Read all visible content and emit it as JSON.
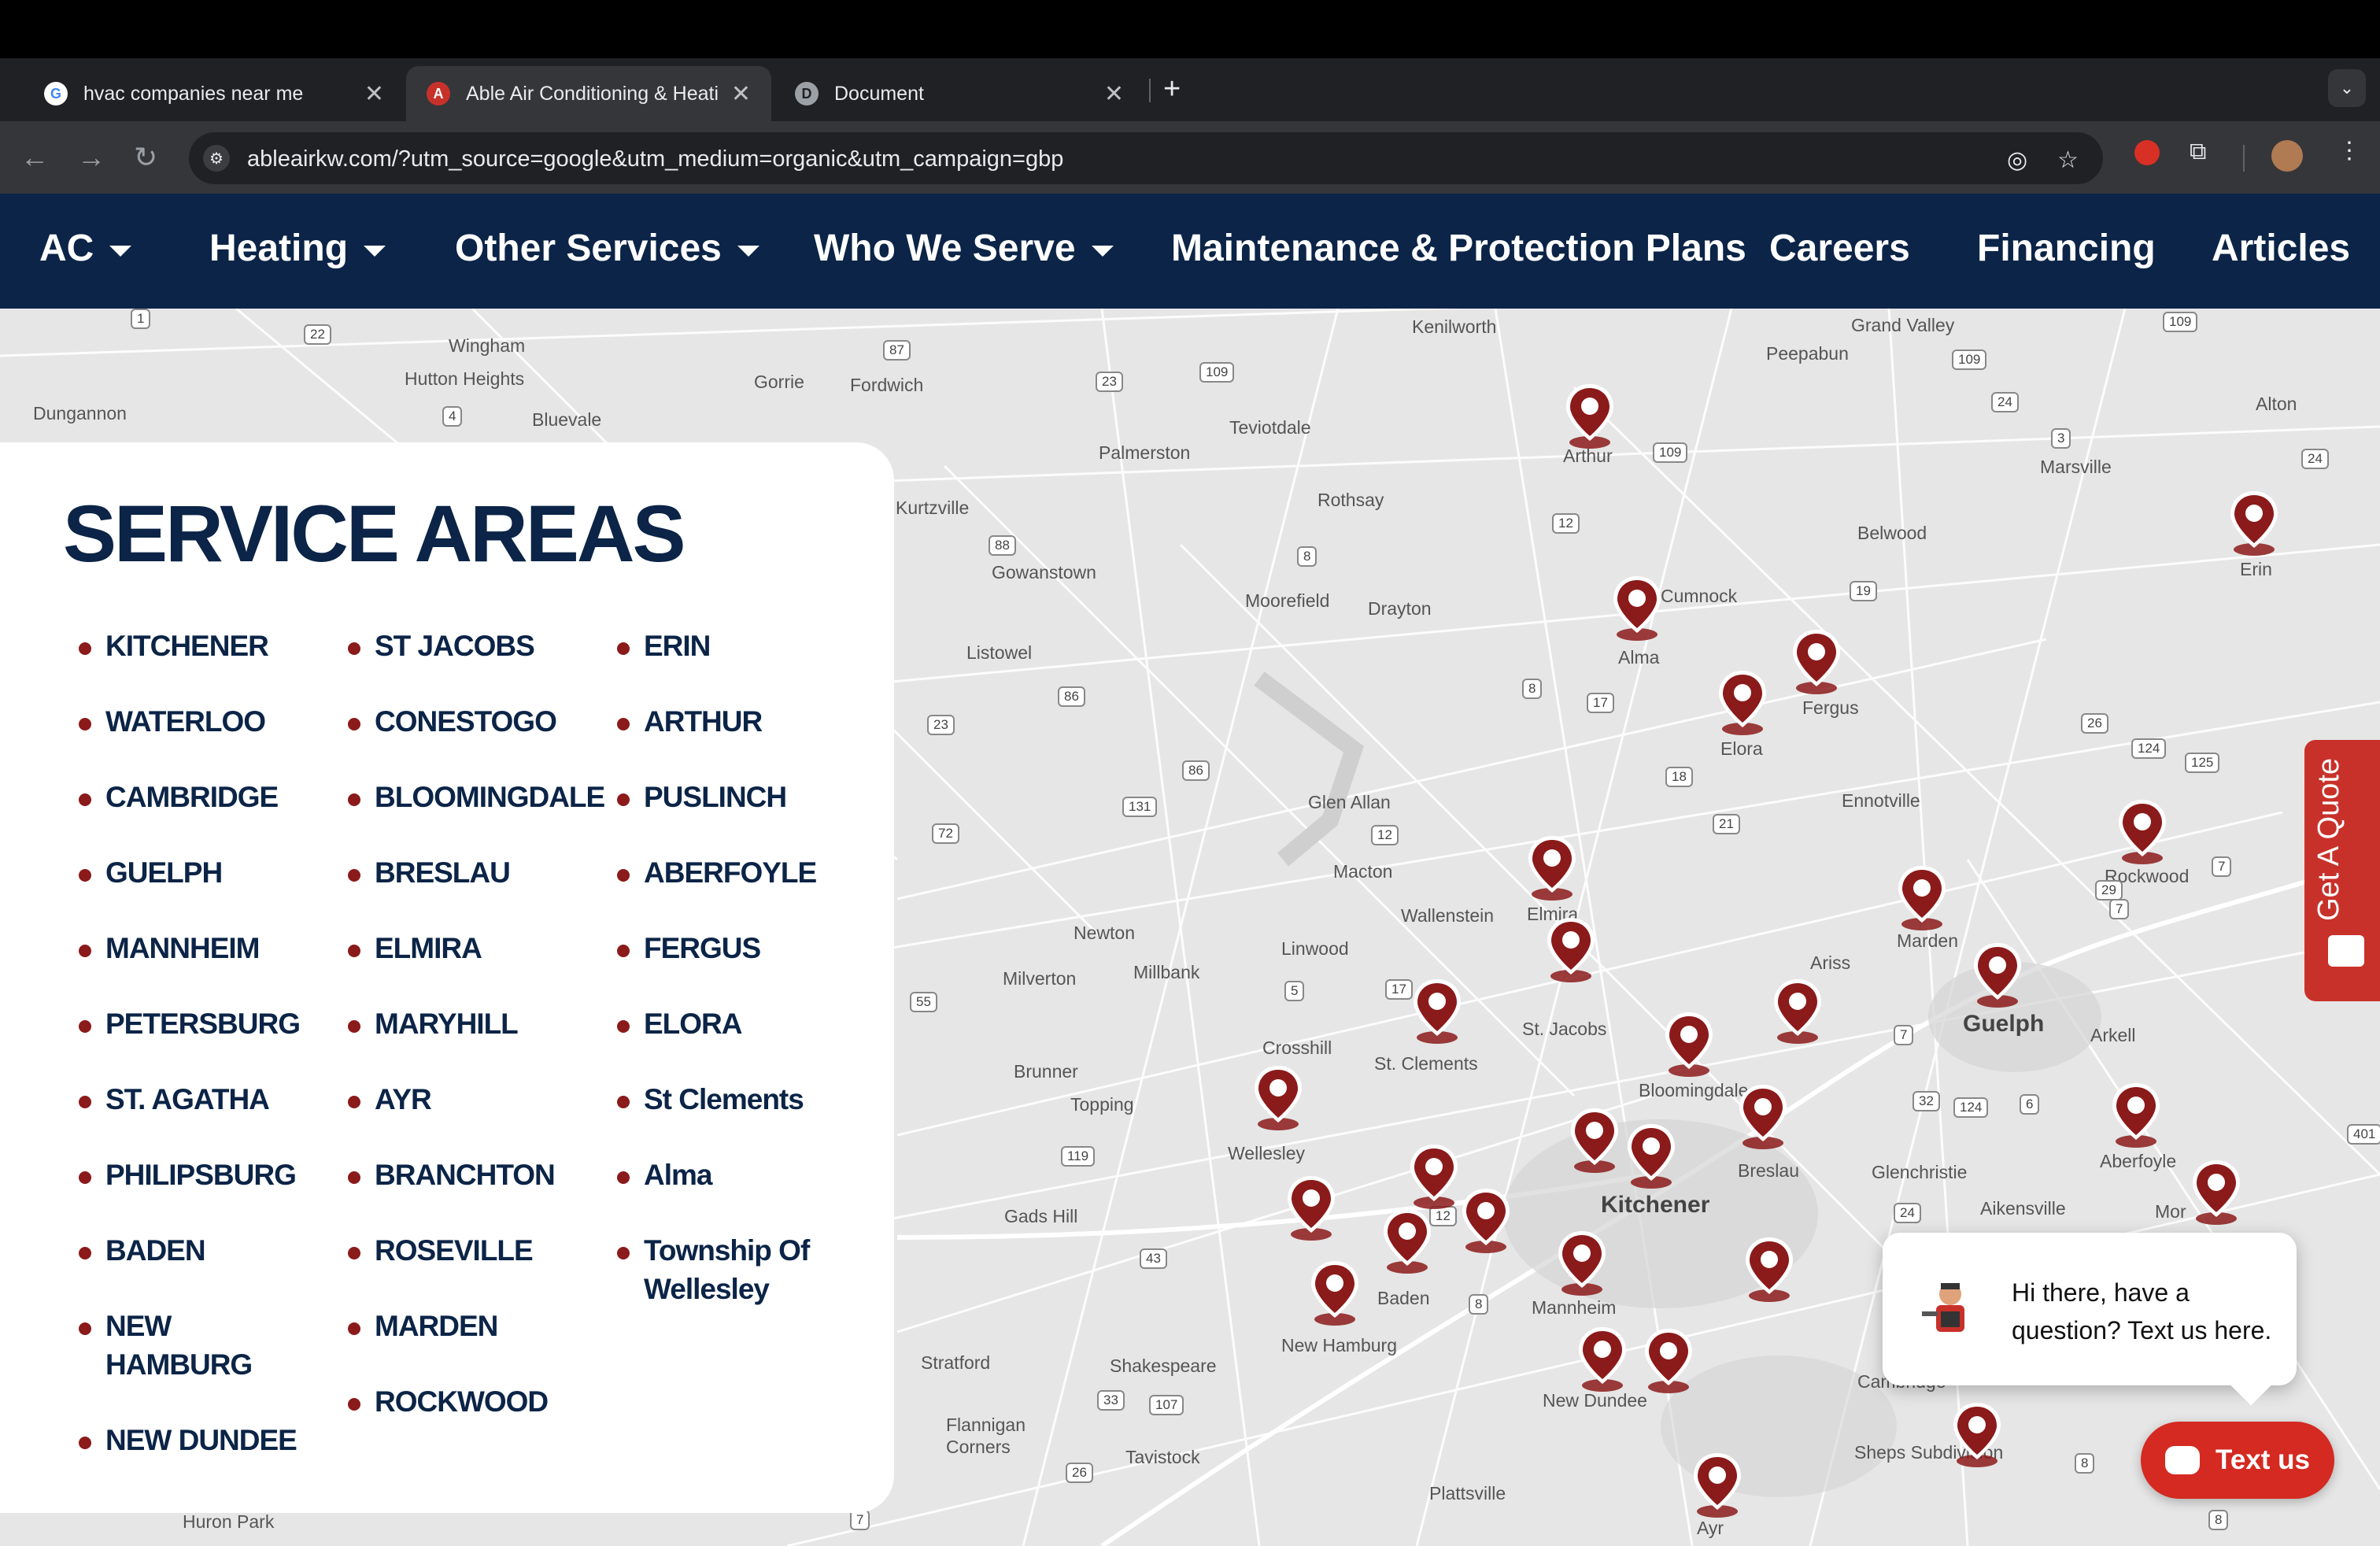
{
  "browser": {
    "tabs": [
      {
        "title": "hvac companies near me",
        "favicon": "G"
      },
      {
        "title": "Able Air Conditioning & Heati",
        "favicon": "A"
      },
      {
        "title": "Document",
        "favicon": "D"
      }
    ],
    "url": "ableairkw.com/?utm_source=google&utm_medium=organic&utm_campaign=gbp",
    "close_glyph": "✕",
    "new_tab_glyph": "+"
  },
  "nav": {
    "items": [
      "AC",
      "Heating",
      "Other Services",
      "Who We Serve",
      "Maintenance & Protection Plans",
      "Careers",
      "Financing",
      "Articles"
    ]
  },
  "service_areas": {
    "title": "SERVICE AREAS",
    "col1": [
      "KITCHENER",
      "WATERLOO",
      "CAMBRIDGE",
      "GUELPH",
      "MANNHEIM",
      "PETERSBURG",
      "ST. AGATHA",
      "PHILIPSBURG",
      "BADEN",
      "NEW HAMBURG",
      "NEW DUNDEE"
    ],
    "col2": [
      "ST JACOBS",
      "CONESTOGO",
      "BLOOMINGDALE",
      "BRESLAU",
      "ELMIRA",
      "MARYHILL",
      "AYR",
      "BRANCHTON",
      "ROSEVILLE",
      "MARDEN",
      "ROCKWOOD"
    ],
    "col3": [
      "ERIN",
      "ARTHUR",
      "PUSLINCH",
      "ABERFOYLE",
      "FERGUS",
      "ELORA",
      "St Clements",
      "Alma",
      "Township Of Wellesley"
    ]
  },
  "map": {
    "towns": [
      "Kenilworth",
      "Grand Valley",
      "Peepabun",
      "Wingham",
      "Hutton Heights",
      "Gorrie",
      "Fordwich",
      "Bluevale",
      "Dungannon",
      "Teviotdale",
      "Palmerston",
      "Arthur",
      "Marsville",
      "Alton",
      "Rothsay",
      "Kurtzville",
      "Gowanstown",
      "Belwood",
      "Moorefield",
      "Drayton",
      "Cumnock",
      "Alma",
      "Erin",
      "Listowel",
      "Fergus",
      "Elora",
      "Ennotville",
      "Glen Allan",
      "Macton",
      "Wallenstein",
      "Elmira",
      "Rockwood",
      "Newton",
      "Milverton",
      "Millbank",
      "Linwood",
      "Marden",
      "Ariss",
      "Guelph",
      "St. Jacobs",
      "Crosshill",
      "St. Clements",
      "Brunner",
      "Topping",
      "Bloomingdale",
      "Arkell",
      "Wellesley",
      "Breslau",
      "Glenchristie",
      "Aberfoyle",
      "Kitchener",
      "Gads Hill",
      "Aikensville",
      "Baden",
      "Mannheim",
      "New Hamburg",
      "Stratford",
      "Shakespeare",
      "New Dundee",
      "Flannigan Corners",
      "Tavistock",
      "Sheps Subdivision",
      "Plattsville",
      "Ayr",
      "Huron Park",
      "Cambridge",
      "Mor"
    ],
    "pin_color": "#8b1a1a",
    "land_color": "#e6e6e6",
    "road_color": "#ffffff"
  },
  "widgets": {
    "quote_label": "Get A Quote",
    "chat_message": "Hi there, have a question? Text us here.",
    "textus_label": "Text us"
  }
}
